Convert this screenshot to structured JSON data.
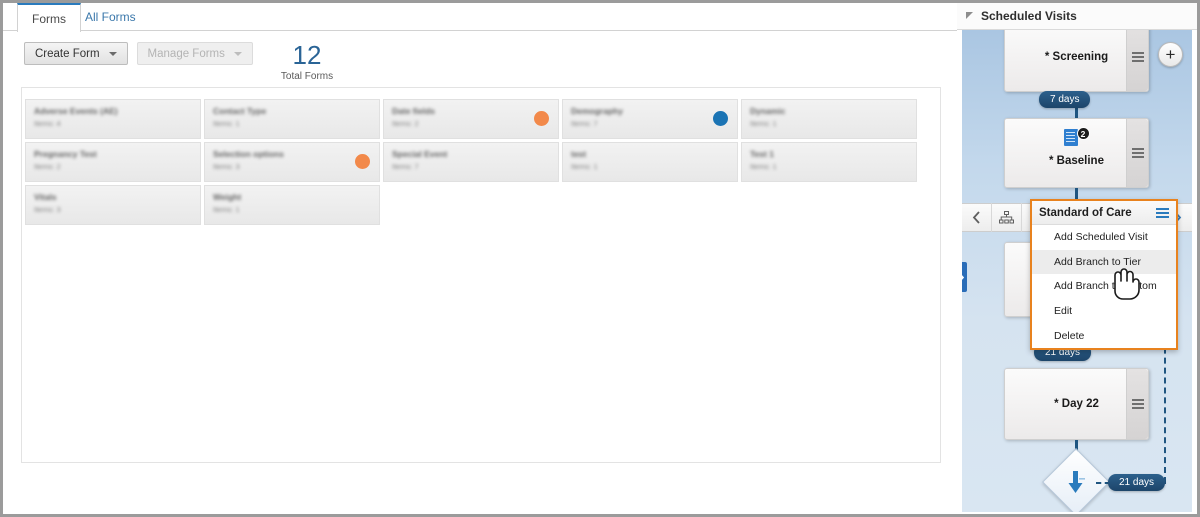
{
  "tabs": [
    {
      "label": "Forms",
      "active": true
    },
    {
      "label": "All Forms",
      "active": false
    }
  ],
  "toolbar": {
    "create_form_label": "Create Form",
    "manage_forms_label": "Manage Forms",
    "total_count": "12",
    "total_label": "Total Forms"
  },
  "form_cards": [
    {
      "title": "Adverse Events (AE)",
      "subtitle": "Items: 4",
      "dot": null
    },
    {
      "title": "Contact Type",
      "subtitle": "Items: 1",
      "dot": null
    },
    {
      "title": "Date fields",
      "subtitle": "Items: 2",
      "dot": "#f2894a"
    },
    {
      "title": "Demography",
      "subtitle": "Items: 7",
      "dot": "#1b74b4"
    },
    {
      "title": "Dynamic",
      "subtitle": "Items: 1",
      "dot": null
    },
    {
      "title": "Pregnancy Test",
      "subtitle": "Items: 2",
      "dot": null
    },
    {
      "title": "Selection options",
      "subtitle": "Items: 3",
      "dot": "#f2894a"
    },
    {
      "title": "Special Event",
      "subtitle": "Items: 7",
      "dot": null
    },
    {
      "title": "test",
      "subtitle": "Items: 1",
      "dot": null
    },
    {
      "title": "Test 1",
      "subtitle": "Items: 1",
      "dot": null
    },
    {
      "title": "Vitals",
      "subtitle": "Items: 3",
      "dot": null
    },
    {
      "title": "Weight",
      "subtitle": "Items: 1",
      "dot": null
    }
  ],
  "scheduled_visits": {
    "panel_title": "Scheduled Visits",
    "add_button_label": "+",
    "nodes": [
      {
        "label": "* Screening",
        "doc_count": null
      },
      {
        "label": "* Baseline",
        "doc_count": "2"
      },
      {
        "label": "* Day 22",
        "doc_count": null
      }
    ],
    "connectors": [
      {
        "label": "7 days"
      },
      {
        "label": "21 days"
      },
      {
        "label": "21 days"
      }
    ],
    "nav": {
      "prev_icon": "chevron-left-icon",
      "tier_icon": "hierarchy-icon",
      "next_icon": "chevron-right-icon"
    },
    "context_menu": {
      "title": "Standard of Care",
      "items": [
        {
          "label": "Add Scheduled Visit",
          "hovered": false
        },
        {
          "label": "Add Branch to Tier",
          "hovered": true
        },
        {
          "label": "Add Branch to Bottom",
          "hovered": false
        },
        {
          "label": "Edit",
          "hovered": false
        },
        {
          "label": "Delete",
          "hovered": false
        }
      ]
    },
    "collapse_handle_icon": "chevron-right-icon"
  },
  "colors": {
    "accent_blue": "#2a7bbd",
    "menu_highlight": "#e8821e",
    "connector": "#1f5580",
    "dot_orange": "#f2894a",
    "dot_blue": "#1b74b4"
  }
}
